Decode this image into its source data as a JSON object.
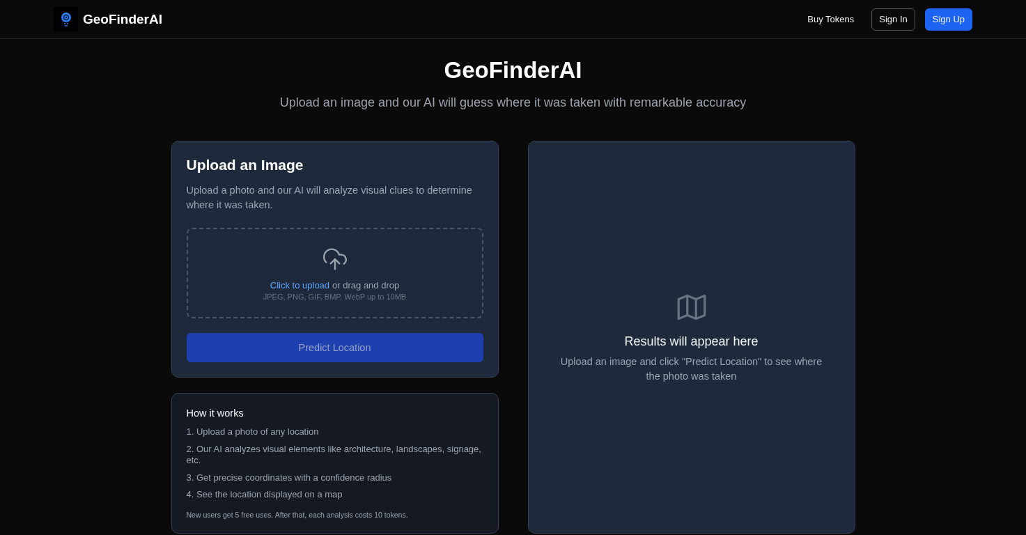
{
  "header": {
    "brand": "GeoFinderAI",
    "nav": [
      {
        "label": "Buy Tokens",
        "kind": "link"
      },
      {
        "label": "Sign In",
        "kind": "outline"
      },
      {
        "label": "Sign Up",
        "kind": "primary"
      }
    ]
  },
  "hero": {
    "title": "GeoFinderAI",
    "subtitle": "Upload an image and our AI will guess where it was taken with remarkable accuracy"
  },
  "upload_card": {
    "title": "Upload an Image",
    "description": "Upload a photo and our AI will analyze visual clues to determine where it was taken.",
    "dropzone": {
      "link": "Click to upload",
      "text": "or drag and drop",
      "hint": "JPEG, PNG, GIF, BMP, WebP up to 10MB"
    },
    "button": {
      "label": "Predict Location",
      "disabled": true
    }
  },
  "how_it_works": {
    "title": "How it works",
    "steps": [
      "1. Upload a photo of any location",
      "2. Our AI analyzes visual elements like architecture, landscapes, signage, etc.",
      "3. Get precise coordinates with a confidence radius",
      "4. See the location displayed on a map"
    ],
    "note": "New users get 5 free uses. After that, each analysis costs 10 tokens."
  },
  "results": {
    "title": "Results will appear here",
    "text": "Upload an image and click \"Predict Location\" to see where the photo was taken"
  }
}
